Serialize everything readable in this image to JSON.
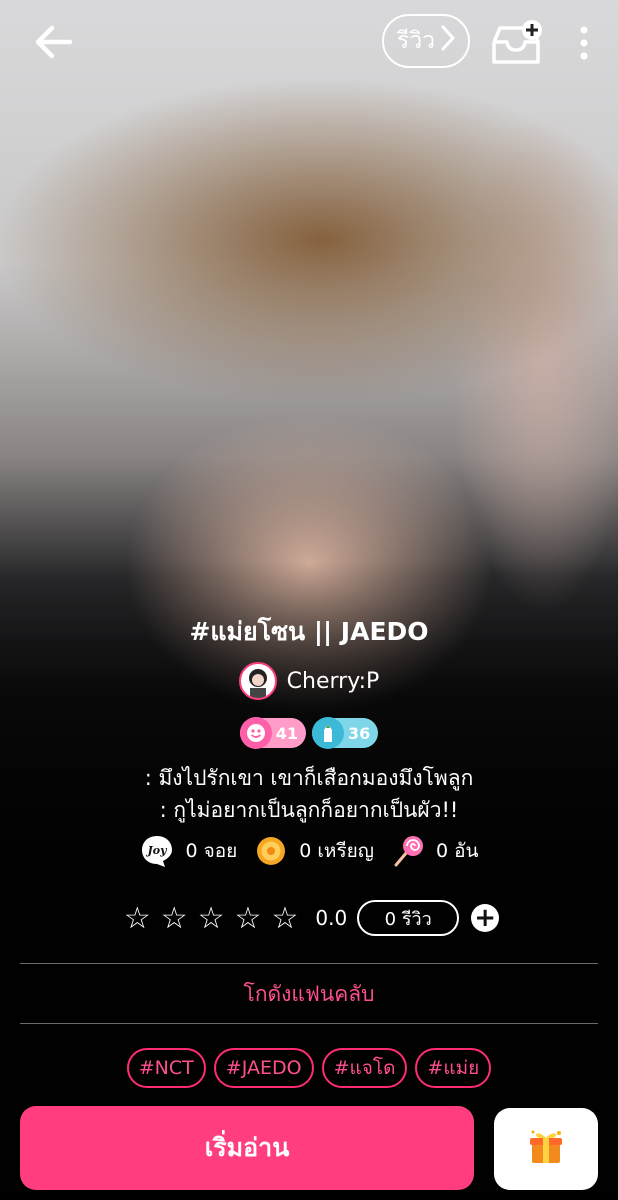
{
  "topbar": {
    "review_label": "รีวิว"
  },
  "book": {
    "title": "#แม่ยโซน || JAEDO",
    "author": "Cherry:P",
    "badges": {
      "level": "41",
      "writer": "36"
    },
    "description": [
      ": มึงไปรักเขา เขาก็เสือกมองมึงโพลูก",
      ": กูไม่อยากเป็นลูกก็อยากเป็นผัว!!"
    ]
  },
  "stats": {
    "joy_icon_text": "Joy",
    "joy": "0 จอย",
    "coins": "0 เหรียญ",
    "candy": "0 อัน"
  },
  "rating": {
    "stars": [
      "☆",
      "☆",
      "☆",
      "☆",
      "☆"
    ],
    "score": "0.0",
    "reviews": "0 รีวิว"
  },
  "fanclub_label": "โกดังแฟนคลับ",
  "tags": [
    "#NCT",
    "#JAEDO",
    "#แจโด",
    "#แม่ย"
  ],
  "read_button": "เริ่มอ่าน",
  "colors": {
    "accent": "#ff3d7f",
    "tag_border": "#ff2d70",
    "tag_text": "#ff4f8e"
  }
}
